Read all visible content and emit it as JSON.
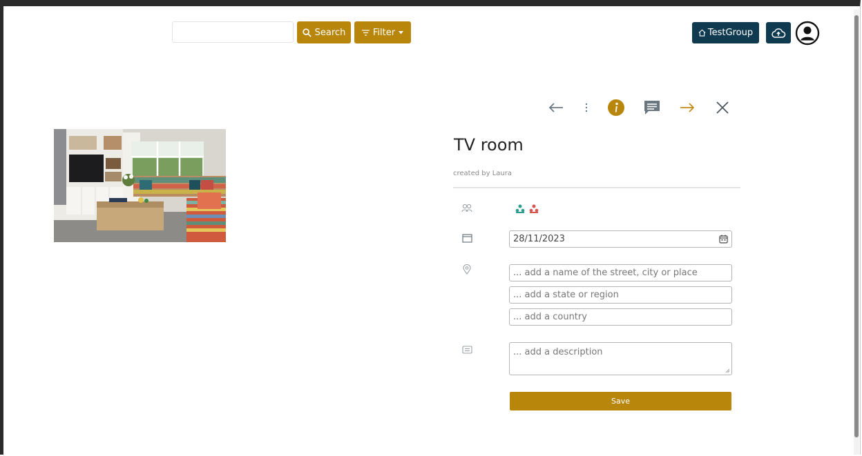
{
  "topbar": {
    "search": {
      "value": "",
      "placeholder": ""
    },
    "search_button": "Search",
    "filter_button": "Filter",
    "group_button": "TestGroup"
  },
  "item": {
    "title": "TV room",
    "created_by": "created by Laura"
  },
  "form": {
    "date": "28/11/2023",
    "street_placeholder": "... add a name of the street, city or place",
    "state_placeholder": "... add a state or region",
    "country_placeholder": "... add a country",
    "description_placeholder": "... add a description",
    "save": "Save"
  },
  "icons": {
    "search": "search-icon",
    "filter": "filter-icon",
    "home": "home-icon",
    "upload": "cloud-upload-icon",
    "profile": "user-circle-icon",
    "back": "arrow-left-icon",
    "more": "more-vertical-icon",
    "info": "info-icon",
    "comment": "comment-icon",
    "forward": "arrow-right-icon",
    "close": "close-icon",
    "people": "people-icon",
    "calendar": "calendar-icon",
    "location": "location-pin-icon",
    "description": "description-icon"
  },
  "colors": {
    "accent_gold": "#b8860b",
    "dark_teal": "#0f3a4f",
    "person_teal": "#2a9d8f",
    "person_red": "#d9534f"
  }
}
